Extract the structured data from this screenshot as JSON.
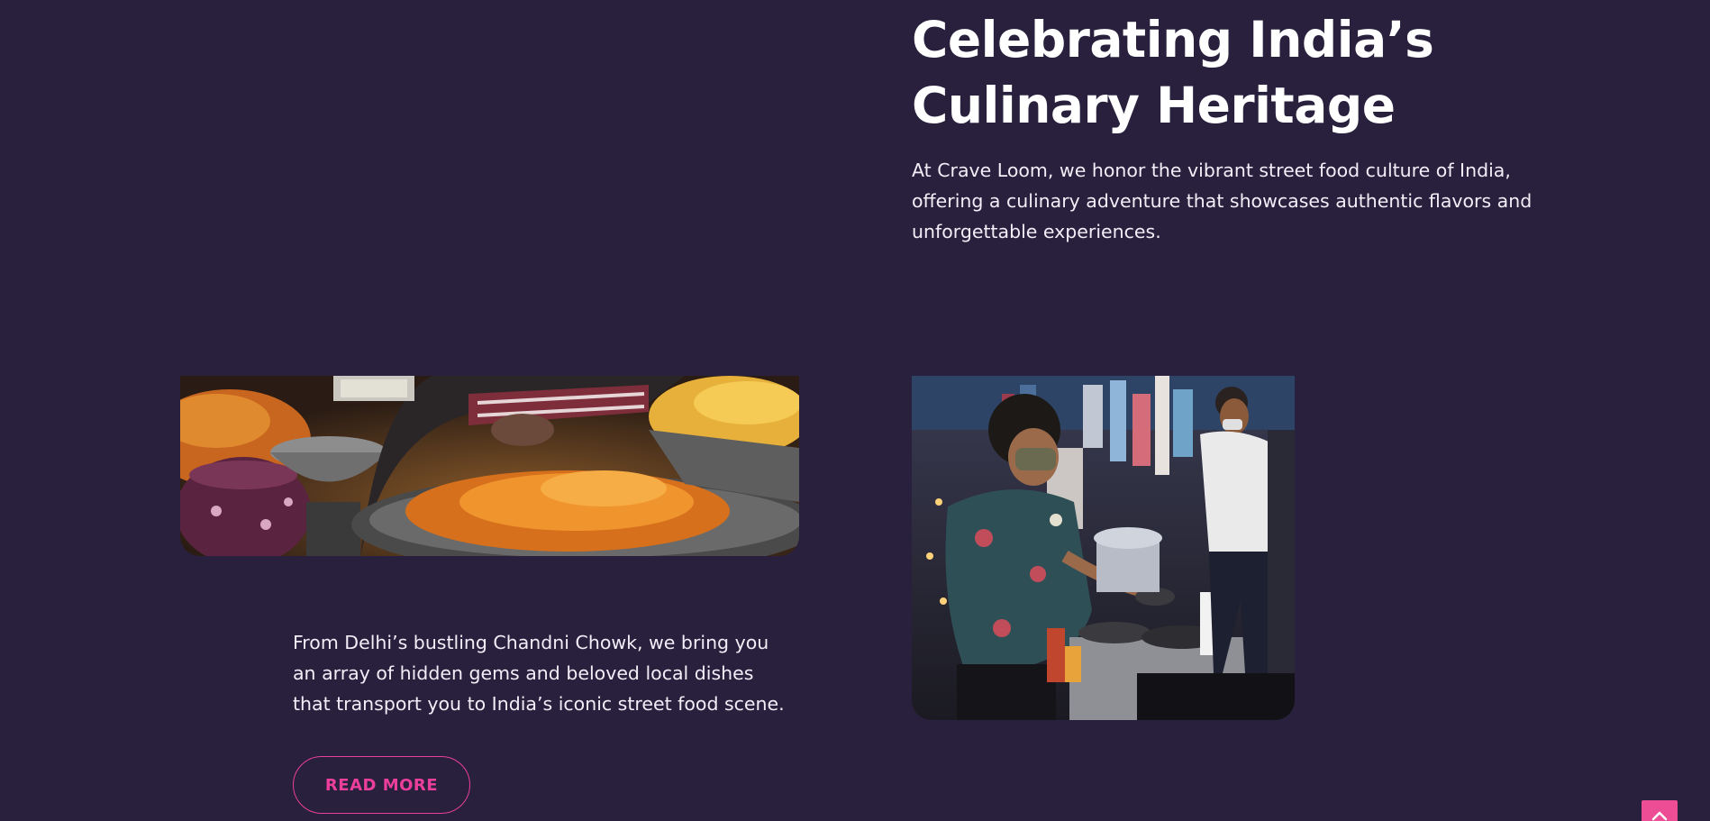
{
  "hero": {
    "title": "Celebrating India’s Culinary Heritage",
    "description": "At Crave Loom, we honor the vibrant street food culture of India, offering a culinary adventure that showcases authentic flavors and unforgettable experiences."
  },
  "story": {
    "text": "From Delhi’s bustling Chandni Chowk, we bring you an array of hidden gems and beloved local dishes that transport you to India’s iconic street food scene.",
    "read_more_label": "READ MORE"
  },
  "images": {
    "snacks": "street-snacks-photo",
    "stall": "street-food-stall-photo"
  },
  "icons": {
    "scroll_top": "chevron-up-icon"
  },
  "colors": {
    "background": "#28203d",
    "accent": "#ec3f9b",
    "scroll_button": "#ec4d95",
    "text": "#ffffff"
  }
}
